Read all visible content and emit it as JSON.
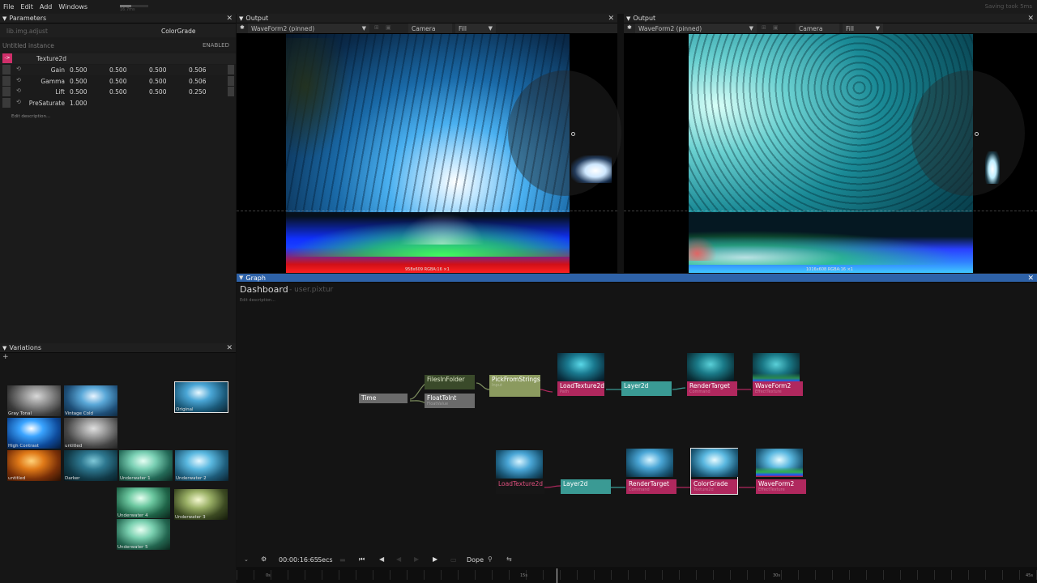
{
  "menu": {
    "items": [
      "File",
      "Edit",
      "Add",
      "Windows"
    ],
    "status": "Saving took 5ms",
    "fps": "16.7ms"
  },
  "colors": {
    "accent_pink": "#cf2f6a",
    "graph_header": "#2e62a8",
    "node_teal": "#3a9a94",
    "node_pink": "#b0285e",
    "node_gray": "#6b6b6b",
    "node_olive": "#8b9a5f"
  },
  "parameters": {
    "title": "Parameters",
    "symbol_path": "lib.img.adjust",
    "symbol_name": "ColorGrade",
    "instance": "Untitled instance",
    "enabled": "ENABLED",
    "input_label": "Texture2d",
    "input_badge": "->",
    "rows": [
      {
        "label": "Gain",
        "v": [
          "0.500",
          "0.500",
          "0.500",
          "0.506"
        ]
      },
      {
        "label": "Gamma",
        "v": [
          "0.500",
          "0.500",
          "0.500",
          "0.506"
        ]
      },
      {
        "label": "Lift",
        "v": [
          "0.500",
          "0.500",
          "0.500",
          "0.250"
        ]
      },
      {
        "label": "PreSaturate",
        "v": [
          "1.000"
        ]
      }
    ],
    "edit_description": "Edit description..."
  },
  "variations": {
    "title": "Variations",
    "add": "+",
    "items": [
      "Gray Tonal",
      "Vintage Cold",
      "Original",
      "High Contrast",
      "untitled",
      "untitled",
      "Darker",
      "Underwater 1",
      "Underwater 2",
      "Underwater 4",
      "Underwater 3",
      "Underwater 5"
    ]
  },
  "output_left": {
    "title": "Output",
    "view": "WaveForm2 (pinned)",
    "camera": "Camera",
    "fill": "Fill",
    "resolution": "958x609 RGBA:16 ×1",
    "pin_icon": "pin-icon"
  },
  "output_right": {
    "title": "Output",
    "view": "WaveForm2 (pinned)",
    "camera": "Camera",
    "fill": "Fill",
    "resolution": "1016x608 RGBA:16 ×1"
  },
  "graph": {
    "title": "Graph",
    "breadcrumb": "Dashboard",
    "subtitle": "- user.pixtur",
    "edit_description": "Edit description...",
    "nodes": {
      "files_in_folder": "FilesInFolder",
      "pick_from_strings": "PickFromStrings",
      "time": "Time",
      "float_to_int": "FloatToInt",
      "load_texture_a": "LoadTexture2d",
      "layer_a": "Layer2d",
      "render_target_a": "RenderTarget",
      "waveform_a": "WaveForm2",
      "load_texture_b": "LoadTexture2d",
      "layer_b": "Layer2d",
      "render_target_b": "RenderTarget",
      "color_grade": "ColorGrade",
      "waveform_b": "WaveForm2"
    },
    "node_subs": {
      "pick": "Input",
      "float_to_int": "FloatValue",
      "load": "Path",
      "render": "Command",
      "wave": "EffectTexture",
      "color": "Texture2d"
    }
  },
  "timeline": {
    "time": "00:00:16:65",
    "unit": "Secs",
    "mode": "Dope",
    "ticks": [
      "0s",
      "15s",
      "30s",
      "45s"
    ]
  }
}
